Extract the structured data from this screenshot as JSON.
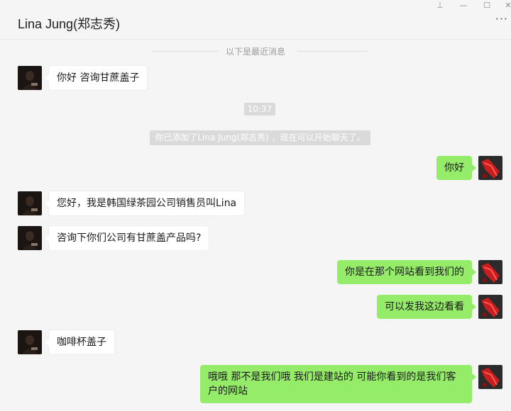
{
  "window": {
    "title": "Lina Jung(郑志秀)",
    "controls": {
      "pin": "⊥",
      "minimize": "—",
      "maximize": "☐",
      "close": "✕"
    },
    "more": "···"
  },
  "chat": {
    "divider": "以下是最近消息",
    "time": "10:37",
    "system_notice": "你已添加了Lina Jung(郑志秀) ，现在可以开始聊天了。",
    "messages": [
      {
        "side": "in",
        "text": "你好 咨询甘蔗盖子"
      },
      {
        "side": "out",
        "text": "你好"
      },
      {
        "side": "in",
        "text": "您好，我是韩国绿茶园公司销售员叫Lina"
      },
      {
        "side": "in",
        "text": "咨询下你们公司有甘蔗盖产品吗?"
      },
      {
        "side": "out",
        "text": "你是在那个网站看到我们的"
      },
      {
        "side": "out",
        "text": "可以发我这边看看"
      },
      {
        "side": "in",
        "text": "咖啡杯盖子"
      },
      {
        "side": "out",
        "text": "哦哦 那不是我们哦 我们是建站的 可能你看到的是我们客户的网站"
      }
    ]
  },
  "colors": {
    "out_bubble": "#95ec69",
    "in_bubble": "#ffffff",
    "background": "#f5f5f5"
  }
}
